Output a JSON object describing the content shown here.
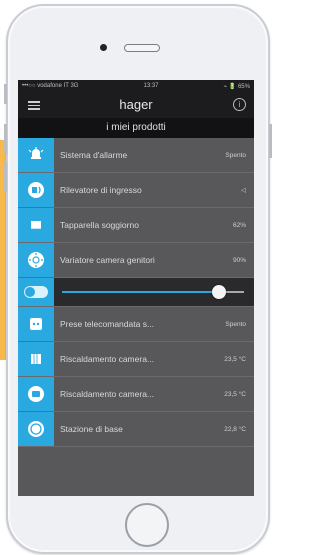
{
  "status": {
    "carrier": "•••○○ vodafone IT  3G",
    "time": "13:37",
    "battery": "⌁ 🔋 65%"
  },
  "navbar": {
    "brand": "hager",
    "info": "i"
  },
  "subheader": "i miei prodotti",
  "items": [
    {
      "label": "Sistema d'allarme",
      "value": "Spento",
      "icon": "alarm-icon"
    },
    {
      "label": "Rilevatore di ingresso",
      "value": "◁",
      "icon": "detector-icon"
    },
    {
      "label": "Tapparella soggiorno",
      "value": "62%",
      "icon": "shutter-icon"
    },
    {
      "label": "Variatore camera genitori",
      "value": "90%",
      "icon": "dimmer-icon"
    }
  ],
  "slider": {
    "level": 0.86
  },
  "items2": [
    {
      "label": "Prese telecomandata s...",
      "value": "Spento",
      "icon": "socket-icon"
    },
    {
      "label": "Riscaldamento camera...",
      "value": "23,5 °C",
      "icon": "heating-icon"
    },
    {
      "label": "Riscaldamento camera...",
      "value": "23,5 °C",
      "icon": "thermostat-icon"
    },
    {
      "label": "Stazione di base",
      "value": "22,8 °C",
      "icon": "gauge-icon"
    }
  ],
  "colors": {
    "accent": "#2aa9e0",
    "orange": "#f7ba4a"
  }
}
